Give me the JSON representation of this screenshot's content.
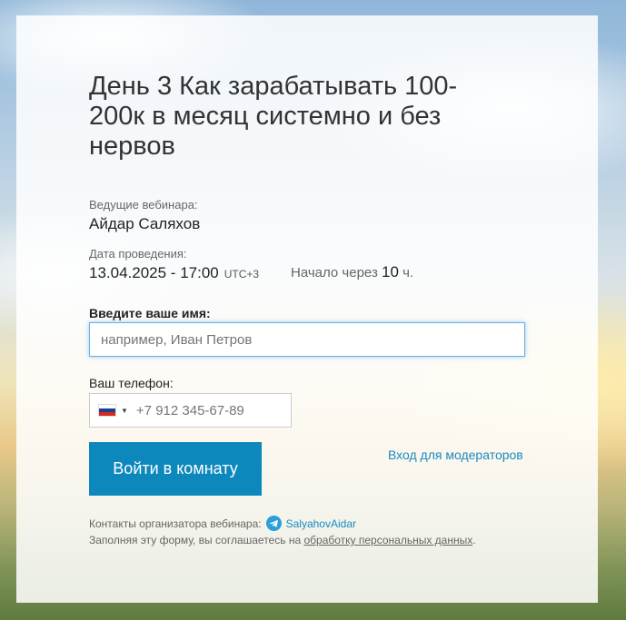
{
  "webinar": {
    "title": "День 3 Как зарабатывать 100-200к в месяц системно и без нервов",
    "hosts_label": "Ведущие вебинара:",
    "host_name": "Айдар Саляхов",
    "date_label": "Дата проведения:",
    "datetime": "13.04.2025 - 17:00",
    "timezone": "UTC+3",
    "starts_in_prefix": "Начало через",
    "starts_in_value": "10",
    "starts_in_unit": "ч."
  },
  "form": {
    "name_label": "Введите ваше имя:",
    "name_placeholder": "например, Иван Петров",
    "phone_label": "Ваш телефон:",
    "phone_placeholder": "+7 912 345-67-89",
    "country_flag": "russia-flag",
    "submit_label": "Войти в комнату",
    "moderator_link": "Вход для модераторов"
  },
  "footer": {
    "contacts_label": "Контакты организатора вебинара:",
    "telegram_handle": "SalyahovAidar",
    "consent_prefix": "Заполняя эту форму, вы соглашаетесь на",
    "consent_link": "обработку персональных данных",
    "consent_suffix": "."
  },
  "colors": {
    "accent": "#0d88bd",
    "link": "#1a8ac0",
    "telegram": "#2a9fd8",
    "focus_border": "#66afe9"
  }
}
